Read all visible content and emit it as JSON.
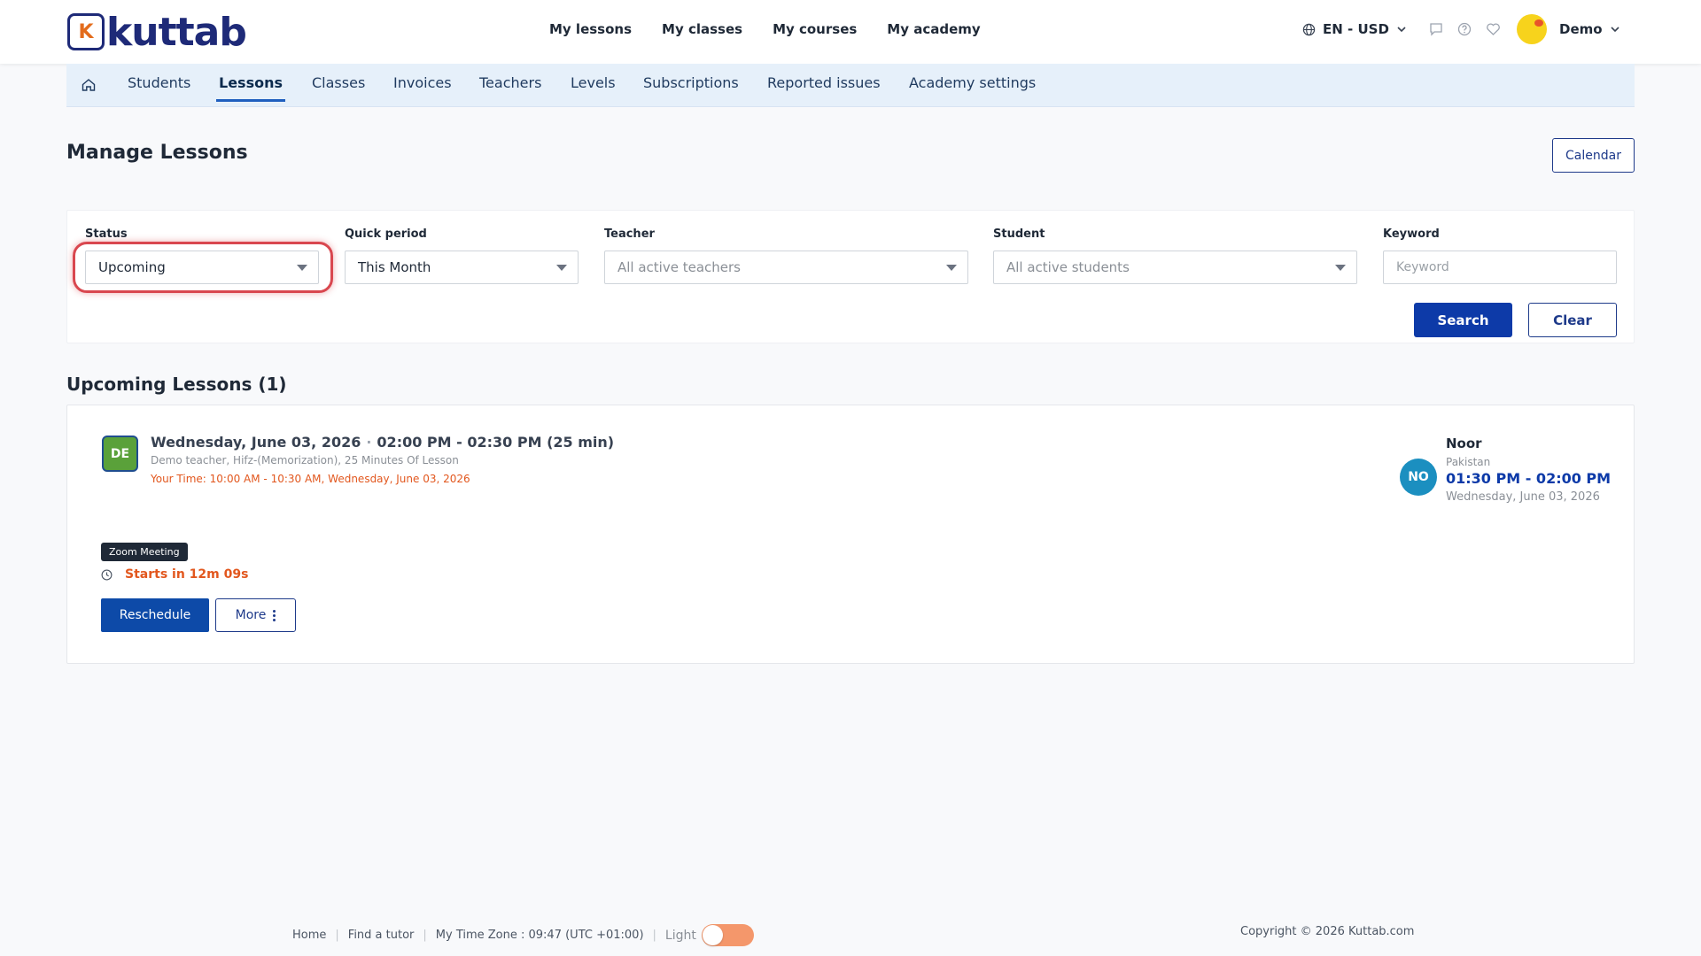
{
  "brand": {
    "logo_letter": "K",
    "logo_word": "kuttab"
  },
  "header": {
    "nav": [
      "My lessons",
      "My classes",
      "My courses",
      "My academy"
    ],
    "language_currency": "EN - USD",
    "user_name": "Demo"
  },
  "subnav": {
    "tabs": [
      "Students",
      "Lessons",
      "Classes",
      "Invoices",
      "Teachers",
      "Levels",
      "Subscriptions",
      "Reported issues",
      "Academy settings"
    ],
    "active": "Lessons"
  },
  "page": {
    "title": "Manage Lessons",
    "calendar_label": "Calendar"
  },
  "filters": {
    "status": {
      "label": "Status",
      "value": "Upcoming"
    },
    "quick_period": {
      "label": "Quick period",
      "value": "This Month"
    },
    "teacher": {
      "label": "Teacher",
      "placeholder": "All active teachers"
    },
    "student": {
      "label": "Student",
      "placeholder": "All active students"
    },
    "keyword": {
      "label": "Keyword",
      "placeholder": "Keyword"
    },
    "search_label": "Search",
    "clear_label": "Clear"
  },
  "lessons": {
    "section_title": "Upcoming Lessons (1)",
    "items": [
      {
        "teacher_initials": "DE",
        "date": "Wednesday, June 03, 2026",
        "time_range": "02:00 PM - 02:30 PM (25 min)",
        "details": "Demo teacher, Hifz-(Memorization), 25 Minutes Of Lesson",
        "your_time": "Your Time: 10:00 AM - 10:30 AM, Wednesday, June 03, 2026",
        "student_initials": "NO",
        "student_name": "Noor",
        "student_country": "Pakistan",
        "student_time": "01:30 PM - 02:00 PM",
        "student_date": "Wednesday, June 03, 2026",
        "meeting_tag": "Zoom Meeting",
        "starts_in": "Starts in 12m 09s",
        "reschedule_label": "Reschedule",
        "more_label": "More"
      }
    ]
  },
  "footer": {
    "links": [
      "Home",
      "Find a tutor"
    ],
    "timezone": "My Time Zone : 09:47 (UTC +01:00)",
    "theme_label": "Light",
    "copyright": "Copyright © 2026 Kuttab.com"
  },
  "colors": {
    "primary": "#0d3aa8",
    "accent_orange": "#e2571e",
    "highlight_ring": "#d9474f",
    "teacher_badge": "#5aa13a",
    "student_badge": "#1b8fc0"
  }
}
